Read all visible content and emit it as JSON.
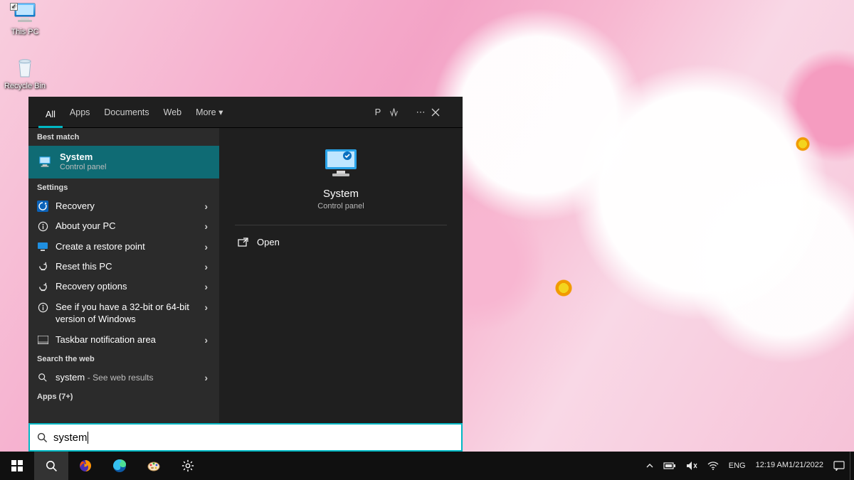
{
  "desktop": {
    "icons": [
      {
        "label": "This PC",
        "kind": "pc"
      },
      {
        "label": "Recycle Bin",
        "kind": "bin"
      }
    ]
  },
  "search": {
    "tabs": {
      "all": "All",
      "apps": "Apps",
      "documents": "Documents",
      "web": "Web",
      "more": "More"
    },
    "header_icons": {
      "profile": "P"
    },
    "sections": {
      "best": "Best match",
      "settings": "Settings",
      "web": "Search the web",
      "apps_more": "Apps (7+)"
    },
    "best_match": {
      "title": "System",
      "subtitle": "Control panel"
    },
    "settings_items": [
      {
        "label": "Recovery",
        "icon": "recovery"
      },
      {
        "label": "About your PC",
        "icon": "info"
      },
      {
        "label": "Create a restore point",
        "icon": "monitor"
      },
      {
        "label": "Reset this PC",
        "icon": "reset"
      },
      {
        "label": "Recovery options",
        "icon": "reset"
      },
      {
        "label": "See if you have a 32-bit or 64-bit version of Windows",
        "icon": "info"
      },
      {
        "label": "Taskbar notification area",
        "icon": "taskbar"
      }
    ],
    "web_item": {
      "term": "system",
      "hint": "See web results"
    },
    "preview": {
      "title": "System",
      "subtitle": "Control panel",
      "open": "Open"
    },
    "input_value": "system"
  },
  "taskbar": {
    "tray": {
      "lang": "ENG",
      "time": "12:19 AM",
      "date": "1/21/2022"
    }
  }
}
